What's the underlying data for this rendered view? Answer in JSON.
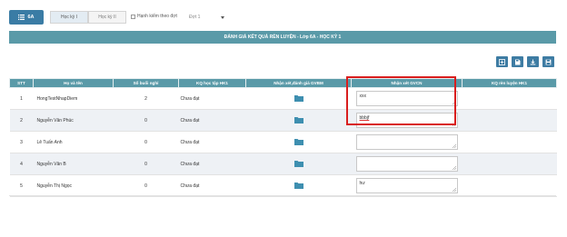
{
  "topbar": {
    "class_label": "6A",
    "tabs": [
      {
        "label": "Học kỳ I",
        "active": true
      },
      {
        "label": "Học kỳ II",
        "active": false
      }
    ],
    "filter_checkbox_label": "Hạnh kiểm theo đợt",
    "period_select": {
      "value": "Đợt 1"
    }
  },
  "title": "ĐÁNH GIÁ KẾT QUẢ RÈN LUYỆN - Lớp 6A - HỌC KỲ 1",
  "toolbar_icons": [
    "plus-icon",
    "save-icon",
    "download-icon",
    "disk-icon"
  ],
  "table": {
    "headers": {
      "stt": "STT",
      "name": "Họ và tên",
      "absences": "Số buổi nghỉ",
      "kq": "KQ học tập HK1",
      "gvbm": "Nhận xét,đánh giá GVBM",
      "gvcn": "Nhận xét GVCN",
      "kqrl": "KQ rèn luyện HK1"
    },
    "rows": [
      {
        "stt": "1",
        "name": "HongTestNhapDiem",
        "absences": "2",
        "kq": "Chưa đạt",
        "note": "xxx"
      },
      {
        "stt": "2",
        "name": "Nguyễn Văn Phúc",
        "absences": "0",
        "kq": "Chưa đạt",
        "note": "bbbjf"
      },
      {
        "stt": "3",
        "name": "Lê Tuấn Anh",
        "absences": "0",
        "kq": "Chưa đạt",
        "note": ""
      },
      {
        "stt": "4",
        "name": "Nguyễn Văn B",
        "absences": "0",
        "kq": "Chưa đạt",
        "note": ""
      },
      {
        "stt": "5",
        "name": "Nguyễn Thị Ngọc",
        "absences": "0",
        "kq": "Chưa đạt",
        "note": "hư"
      }
    ]
  },
  "colors": {
    "primary": "#3a7ca5",
    "header": "#5a9aa8",
    "highlight": "#d91e1e",
    "folder": "#3e8fb0"
  }
}
